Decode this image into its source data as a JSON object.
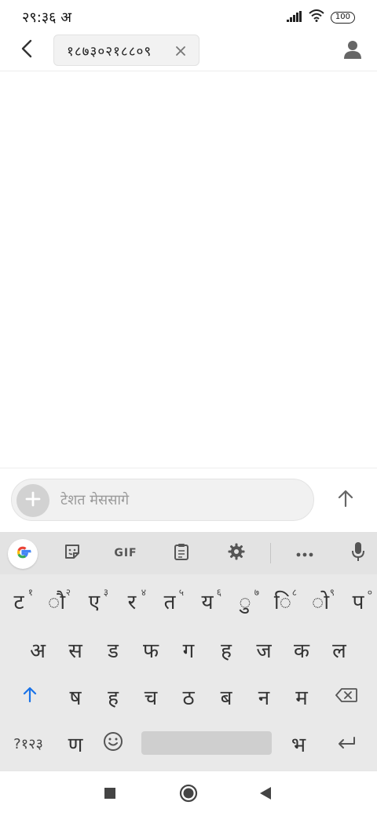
{
  "status_bar": {
    "time": "२९:३६ अ",
    "battery": "100"
  },
  "header": {
    "recipient": "१८७३०२१८८०९"
  },
  "compose": {
    "placeholder": "टेशत मेससागे"
  },
  "keyboard": {
    "toolbar": {
      "gif_label": "GIF"
    },
    "row1": [
      {
        "char": "ट",
        "hint": "१"
      },
      {
        "char": "ौ",
        "hint": "२"
      },
      {
        "char": "ए",
        "hint": "३"
      },
      {
        "char": "र",
        "hint": "४"
      },
      {
        "char": "त",
        "hint": "५"
      },
      {
        "char": "य",
        "hint": "६"
      },
      {
        "char": "ु",
        "hint": "७"
      },
      {
        "char": "ि",
        "hint": "८"
      },
      {
        "char": "ो",
        "hint": "९"
      },
      {
        "char": "प",
        "hint": "०"
      }
    ],
    "row2": [
      "अ",
      "स",
      "ड",
      "फ",
      "ग",
      "ह",
      "ज",
      "क",
      "ल"
    ],
    "row3": [
      "ष",
      "ह",
      "च",
      "ठ",
      "ब",
      "न",
      "म"
    ],
    "row4": {
      "symbols": "?१२३",
      "comma_key": "ण",
      "period_key": "भ"
    }
  },
  "colors": {
    "accent": "#1a73e8",
    "keyboard_bg": "#e9e9e9",
    "toolbar_bg": "#e3e3e3"
  }
}
